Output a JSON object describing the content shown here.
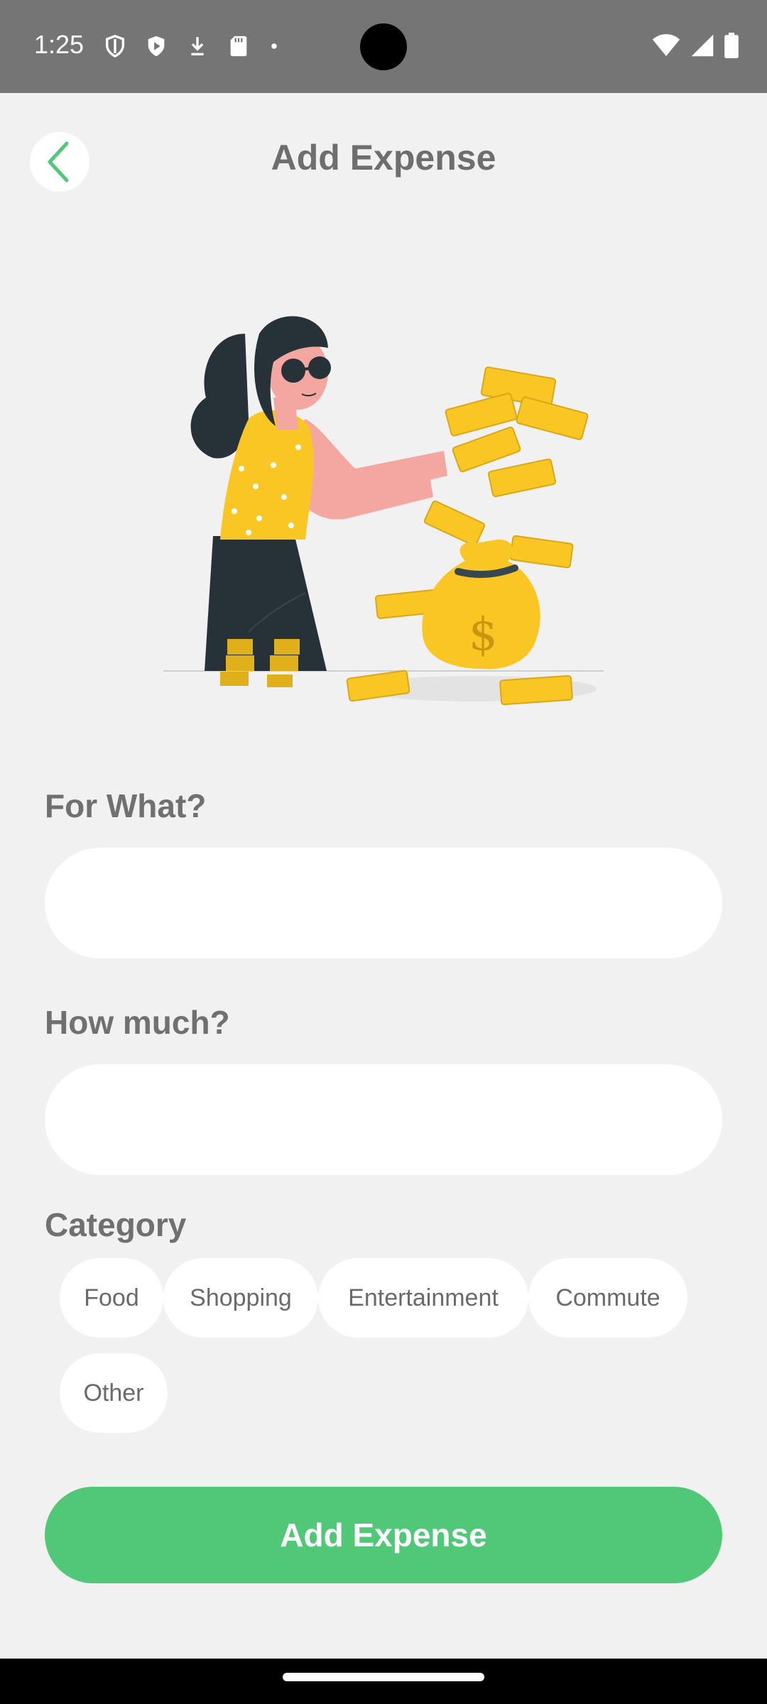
{
  "status_bar": {
    "time": "1:25",
    "icons_left": [
      "shield-icon",
      "play-shield-icon",
      "download-icon",
      "sd-card-icon",
      "dot-icon"
    ],
    "icons_right": [
      "wifi-icon",
      "signal-icon",
      "battery-icon"
    ]
  },
  "header": {
    "title": "Add Expense",
    "back_icon": "chevron-left-icon",
    "accent_color": "#50c878"
  },
  "form": {
    "for_what_label": "For What?",
    "for_what_value": "",
    "how_much_label": "How much?",
    "how_much_value": "",
    "category_label": "Category",
    "categories": [
      "Food",
      "Shopping",
      "Entertainment",
      "Commute",
      "Other"
    ]
  },
  "submit": {
    "label": "Add Expense",
    "color": "#50c878"
  }
}
